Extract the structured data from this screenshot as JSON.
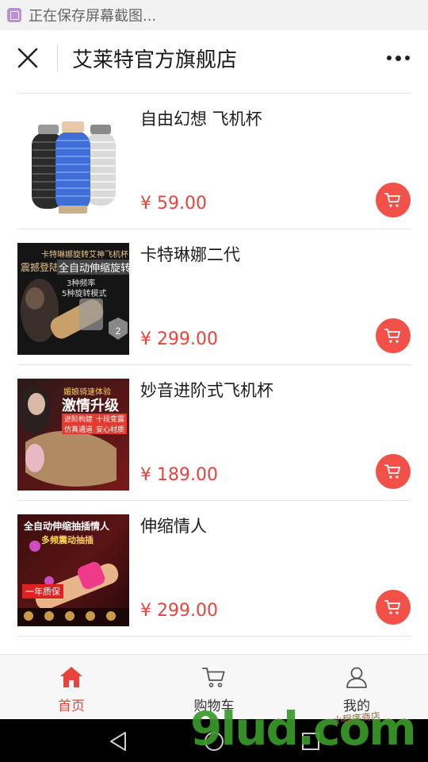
{
  "status_bar": {
    "text": "正在保存屏幕截图..."
  },
  "header": {
    "title": "艾莱特官方旗舰店"
  },
  "products": [
    {
      "name": "自由幻想 飞机杯",
      "price": "¥ 59.00"
    },
    {
      "name": "卡特琳娜二代",
      "price": "¥ 299.00",
      "image_texts": [
        "卡特琳娜旋转艾神飞机杯",
        "震撼登陆",
        "全自动伸缩旋转",
        "3种频率",
        "5种旋转模式"
      ]
    },
    {
      "name": "妙音进阶式飞机杯",
      "price": "¥ 189.00",
      "image_texts": [
        "媚娘骑速体验",
        "激情升级",
        "进阶构建",
        "十段变震",
        "仿真通道",
        "安心材质"
      ]
    },
    {
      "name": "伸缩情人",
      "price": "¥ 299.00",
      "image_texts": [
        "全自动伸缩抽插情人",
        "多频震动抽插",
        "一年质保"
      ]
    }
  ],
  "bottom_nav": [
    {
      "label": "首页",
      "icon": "home-icon",
      "active": true
    },
    {
      "label": "购物车",
      "icon": "cart-icon",
      "active": false
    },
    {
      "label": "我的",
      "icon": "user-icon",
      "active": false
    }
  ],
  "watermark": {
    "text": "9lud.com",
    "small": "小程序商店"
  },
  "colors": {
    "accent": "#e8433c",
    "cart_button": "#f25149"
  }
}
